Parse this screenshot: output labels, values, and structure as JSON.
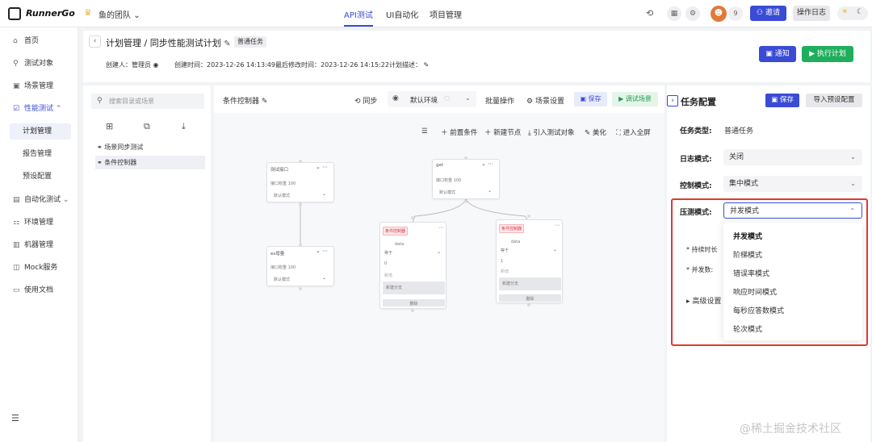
{
  "header": {
    "logo": "RunnerGo",
    "team": "鱼的团队",
    "tabs": [
      "API测试",
      "UI自动化",
      "项目管理"
    ],
    "avatar_count": "9",
    "invite": "邀请",
    "op_log": "操作日志"
  },
  "sidebar": {
    "items": [
      {
        "icon": "⌂",
        "label": "首页"
      },
      {
        "icon": "⚲",
        "label": "测试对象"
      },
      {
        "icon": "▣",
        "label": "场景管理"
      },
      {
        "icon": "☑",
        "label": "性能测试"
      },
      {
        "icon": "▤",
        "label": "自动化测试"
      },
      {
        "icon": "⚏",
        "label": "环境管理"
      },
      {
        "icon": "▥",
        "label": "机器管理"
      },
      {
        "icon": "◫",
        "label": "Mock服务"
      },
      {
        "icon": "▭",
        "label": "使用文档"
      }
    ],
    "perf_sub": [
      "计划管理",
      "报告管理",
      "预设配置"
    ]
  },
  "page": {
    "breadcrumb": "计划管理 / 同步性能测试计划",
    "tag": "普通任务",
    "creator": "创建人：管理员",
    "created": "创建时间：2023-12-26 14:13:49",
    "modified": "最后修改时间：2023-12-26 14:15:22",
    "desc": "计划描述：",
    "notify": "通知",
    "execute": "执行计划"
  },
  "scenes": {
    "search_placeholder": "搜索目录或场景",
    "items": [
      "场景同步测试",
      "条件控制器"
    ]
  },
  "canvas": {
    "label": "条件控制器",
    "sync": "同步",
    "env": "默认环境",
    "batch": "批量操作",
    "scene_settings": "场景设置",
    "save": "保存",
    "debug": "调试场景",
    "tools": [
      "前置条件",
      "新建节点",
      "引入测试对象",
      "美化",
      "进入全屏"
    ],
    "nodes": {
      "n1_title": "测试接口",
      "n2_title": "get",
      "n3_title": "es增量",
      "line_weight": "接口权重",
      "weight_val": "100",
      "mode": "默认模式",
      "cond_tag": "条件控制器",
      "cond_var": "data",
      "cond_op": "等于",
      "cond_val0": "0",
      "cond_val1": "1",
      "add_label": "新增",
      "add_btn": "新建分支",
      "bottom_btn": "删除"
    }
  },
  "config": {
    "title": "任务配置",
    "save": "保存",
    "import": "导入预设配置",
    "task_type_label": "任务类型:",
    "task_type_value": "普通任务",
    "log_mode_label": "日志模式:",
    "log_mode_value": "关闭",
    "control_mode_label": "控制模式:",
    "control_mode_value": "集中模式",
    "press_mode_label": "压测模式:",
    "press_mode_value": "并发模式",
    "options": [
      "并发模式",
      "阶梯模式",
      "错误率模式",
      "响应时间模式",
      "每秒应答数模式",
      "轮次模式"
    ],
    "hidden_fields": [
      "* 持续时长",
      "* 并发数:",
      "▸  高级设置"
    ]
  },
  "watermark": "@稀土掘金技术社区"
}
